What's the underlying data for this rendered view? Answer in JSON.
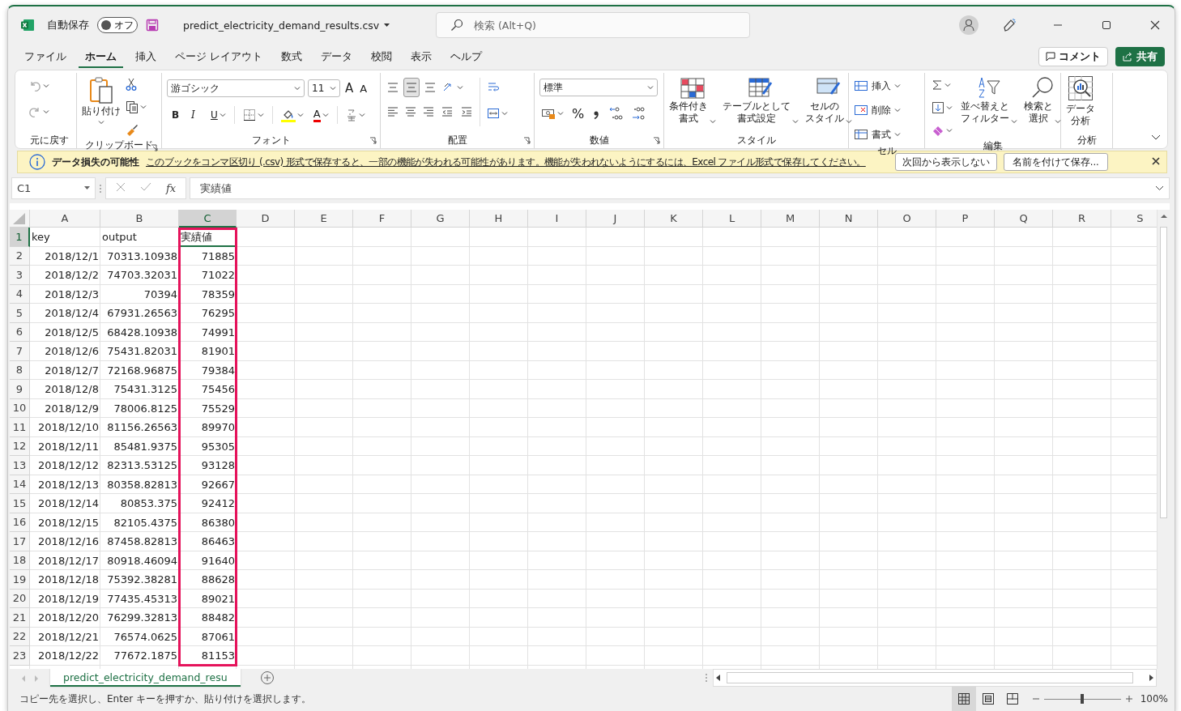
{
  "titlebar": {
    "autosave_label": "自動保存",
    "autosave": {
      "label": "オフ",
      "on": false
    },
    "filename": "predict_electricity_demand_results.csv",
    "search": {
      "placeholder": "検索 (Alt+Q)"
    }
  },
  "menu": {
    "tabs": [
      {
        "label": "ファイル",
        "selected": false
      },
      {
        "label": "ホーム",
        "selected": true
      },
      {
        "label": "挿入",
        "selected": false
      },
      {
        "label": "ページ レイアウト",
        "selected": false
      },
      {
        "label": "数式",
        "selected": false
      },
      {
        "label": "データ",
        "selected": false
      },
      {
        "label": "校閲",
        "selected": false
      },
      {
        "label": "表示",
        "selected": false
      },
      {
        "label": "ヘルプ",
        "selected": false
      }
    ],
    "comment": "コメント",
    "share": "共有"
  },
  "ribbon": {
    "groups": [
      {
        "kind": "undo",
        "label": "元に戻す"
      },
      {
        "kind": "clipboard",
        "label": "クリップボード",
        "paste": "貼り付け"
      },
      {
        "kind": "font",
        "label": "フォント",
        "font": "游ゴシック",
        "size": "11",
        "grow": "A",
        "shrink": "A",
        "bold": "B",
        "italic": "I",
        "underline": "U",
        "font_color_label": "A"
      },
      {
        "kind": "alignment",
        "label": "配置"
      },
      {
        "kind": "number",
        "label": "数値",
        "format": "標準",
        "percent": "%"
      },
      {
        "kind": "styles",
        "label": "スタイル",
        "buttons": [
          {
            "lines": [
              "条件付き",
              "書式"
            ]
          },
          {
            "lines": [
              "テーブルとして",
              "書式設定"
            ]
          },
          {
            "lines": [
              "セルの",
              "スタイル"
            ]
          }
        ]
      },
      {
        "kind": "cells",
        "label": "セル",
        "buttons": [
          "挿入",
          "削除",
          "書式"
        ]
      },
      {
        "kind": "editing",
        "label": "編集",
        "buttons": [
          {
            "lines": [
              "並べ替えと",
              "フィルター"
            ]
          },
          {
            "lines": [
              "検索と",
              "選択"
            ]
          }
        ]
      },
      {
        "kind": "analysis",
        "label": "分析",
        "buttons": [
          {
            "lines": [
              "データ",
              "分析"
            ]
          }
        ]
      }
    ]
  },
  "infobar": {
    "title": "データ損失の可能性",
    "message": "このブックをコンマ区切り (.csv) 形式で保存すると、一部の機能が失われる可能性があります。機能が失われないようにするには、Excel ファイル形式で保存してください。",
    "buttons": [
      "次回から表示しない",
      "名前を付けて保存..."
    ]
  },
  "formula_bar": {
    "name_box": "C1",
    "function_label": "fx",
    "value": "実績値"
  },
  "sheet": {
    "columns": [
      {
        "label": "A",
        "selected": false,
        "highlighted": false
      },
      {
        "label": "B",
        "selected": false,
        "highlighted": false
      },
      {
        "label": "C",
        "selected": true,
        "highlighted": true
      },
      {
        "label": "D",
        "selected": false,
        "highlighted": false
      },
      {
        "label": "E",
        "selected": false,
        "highlighted": false
      },
      {
        "label": "F",
        "selected": false,
        "highlighted": false
      },
      {
        "label": "G",
        "selected": false,
        "highlighted": false
      },
      {
        "label": "H",
        "selected": false,
        "highlighted": false
      },
      {
        "label": "I",
        "selected": false,
        "highlighted": false
      },
      {
        "label": "J",
        "selected": false,
        "highlighted": false
      },
      {
        "label": "K",
        "selected": false,
        "highlighted": false
      },
      {
        "label": "L",
        "selected": false,
        "highlighted": false
      },
      {
        "label": "M",
        "selected": false,
        "highlighted": false
      },
      {
        "label": "N",
        "selected": false,
        "highlighted": false
      },
      {
        "label": "O",
        "selected": false,
        "highlighted": false
      },
      {
        "label": "P",
        "selected": false,
        "highlighted": false
      },
      {
        "label": "Q",
        "selected": false,
        "highlighted": false
      },
      {
        "label": "R",
        "selected": false,
        "highlighted": false
      },
      {
        "label": "S",
        "selected": false,
        "highlighted": false
      }
    ],
    "rows": [
      {
        "header": "1",
        "selected": true,
        "kind": "text",
        "cells": [
          "key",
          "output",
          "実績値"
        ]
      },
      {
        "header": "2",
        "selected": false,
        "kind": "number",
        "cells": [
          "2018/12/1",
          "70313.10938",
          "71885"
        ]
      },
      {
        "header": "3",
        "selected": false,
        "kind": "number",
        "cells": [
          "2018/12/2",
          "74703.32031",
          "71022"
        ]
      },
      {
        "header": "4",
        "selected": false,
        "kind": "number",
        "cells": [
          "2018/12/3",
          "70394",
          "78359"
        ]
      },
      {
        "header": "5",
        "selected": false,
        "kind": "number",
        "cells": [
          "2018/12/4",
          "67931.26563",
          "76295"
        ]
      },
      {
        "header": "6",
        "selected": false,
        "kind": "number",
        "cells": [
          "2018/12/5",
          "68428.10938",
          "74991"
        ]
      },
      {
        "header": "7",
        "selected": false,
        "kind": "number",
        "cells": [
          "2018/12/6",
          "75431.82031",
          "81901"
        ]
      },
      {
        "header": "8",
        "selected": false,
        "kind": "number",
        "cells": [
          "2018/12/7",
          "72168.96875",
          "79384"
        ]
      },
      {
        "header": "9",
        "selected": false,
        "kind": "number",
        "cells": [
          "2018/12/8",
          "75431.3125",
          "75456"
        ]
      },
      {
        "header": "10",
        "selected": false,
        "kind": "number",
        "cells": [
          "2018/12/9",
          "78006.8125",
          "75529"
        ]
      },
      {
        "header": "11",
        "selected": false,
        "kind": "number",
        "cells": [
          "2018/12/10",
          "81156.26563",
          "89970"
        ]
      },
      {
        "header": "12",
        "selected": false,
        "kind": "number",
        "cells": [
          "2018/12/11",
          "85481.9375",
          "95305"
        ]
      },
      {
        "header": "13",
        "selected": false,
        "kind": "number",
        "cells": [
          "2018/12/12",
          "82313.53125",
          "93128"
        ]
      },
      {
        "header": "14",
        "selected": false,
        "kind": "number",
        "cells": [
          "2018/12/13",
          "80358.82813",
          "92667"
        ]
      },
      {
        "header": "15",
        "selected": false,
        "kind": "number",
        "cells": [
          "2018/12/14",
          "80853.375",
          "92412"
        ]
      },
      {
        "header": "16",
        "selected": false,
        "kind": "number",
        "cells": [
          "2018/12/15",
          "82105.4375",
          "86380"
        ]
      },
      {
        "header": "17",
        "selected": false,
        "kind": "number",
        "cells": [
          "2018/12/16",
          "87458.82813",
          "86463"
        ]
      },
      {
        "header": "18",
        "selected": false,
        "kind": "number",
        "cells": [
          "2018/12/17",
          "80918.46094",
          "91640"
        ]
      },
      {
        "header": "19",
        "selected": false,
        "kind": "number",
        "cells": [
          "2018/12/18",
          "75392.38281",
          "88628"
        ]
      },
      {
        "header": "20",
        "selected": false,
        "kind": "number",
        "cells": [
          "2018/12/19",
          "77435.45313",
          "89021"
        ]
      },
      {
        "header": "21",
        "selected": false,
        "kind": "number",
        "cells": [
          "2018/12/20",
          "76299.32813",
          "88482"
        ]
      },
      {
        "header": "22",
        "selected": false,
        "kind": "number",
        "cells": [
          "2018/12/21",
          "76574.0625",
          "87061"
        ]
      },
      {
        "header": "23",
        "selected": false,
        "kind": "number",
        "cells": [
          "2018/12/22",
          "77672.1875",
          "81153"
        ]
      }
    ]
  },
  "sheet_tabs": [
    {
      "label": "predict_electricity_demand_resu",
      "selected": true
    }
  ],
  "status_bar": {
    "message": "コピー先を選択し、Enter キーを押すか、貼り付けを選択します。",
    "views": [
      {
        "kind": "normal",
        "selected": true
      },
      {
        "kind": "page_layout",
        "selected": false
      },
      {
        "kind": "page_break",
        "selected": false
      }
    ],
    "zoom": {
      "level": 0.5,
      "label": "100%"
    }
  }
}
